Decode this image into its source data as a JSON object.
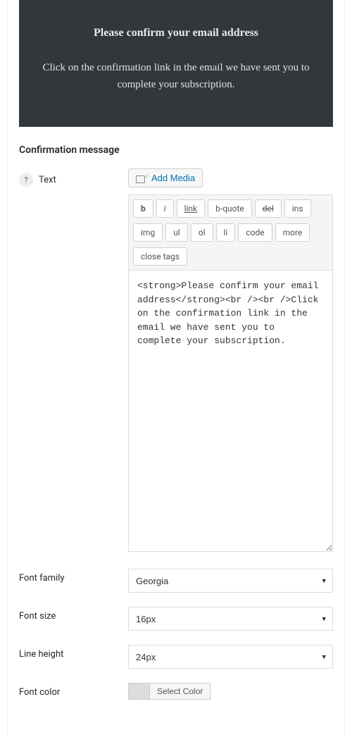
{
  "preview": {
    "title": "Please confirm your email address",
    "body": "Click on the confirmation link in the email we have sent you to complete your subscription."
  },
  "section_heading": "Confirmation message",
  "fields": {
    "text": {
      "label": "Text",
      "add_media_label": "Add Media",
      "quicktags": {
        "b": "b",
        "i": "i",
        "link": "link",
        "bquote": "b-quote",
        "del": "del",
        "ins": "ins",
        "img": "img",
        "ul": "ul",
        "ol": "ol",
        "li": "li",
        "code": "code",
        "more": "more",
        "close": "close tags"
      },
      "value": "<strong>Please confirm your email address</strong><br /><br />Click on the confirmation link in the email we have sent you to complete your subscription."
    },
    "font_family": {
      "label": "Font family",
      "value": "Georgia"
    },
    "font_size": {
      "label": "Font size",
      "value": "16px"
    },
    "line_height": {
      "label": "Line height",
      "value": "24px"
    },
    "font_color": {
      "label": "Font color",
      "button_label": "Select Color",
      "swatch": "#dddddd"
    }
  },
  "help_icon_text": "?"
}
